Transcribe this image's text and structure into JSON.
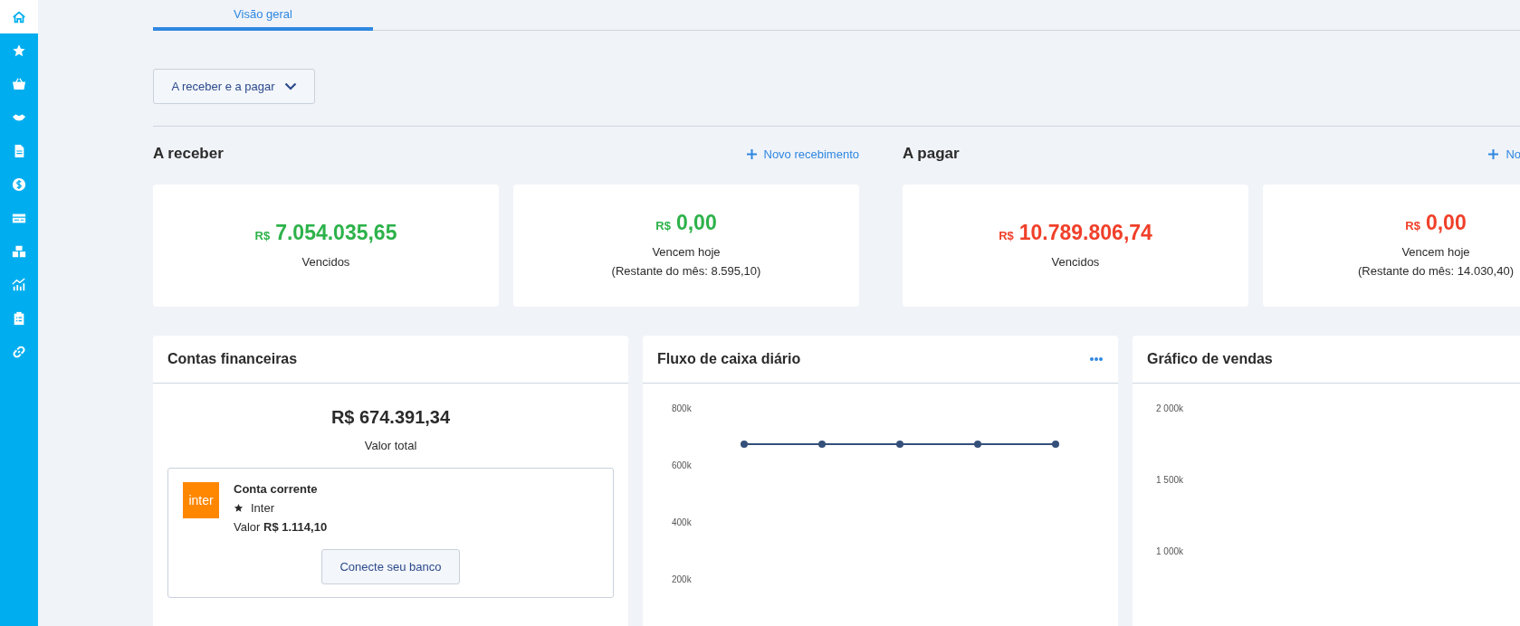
{
  "sidebar": {
    "items": [
      {
        "selected": true
      },
      {
        "selected": false
      },
      {
        "selected": false
      },
      {
        "selected": false
      },
      {
        "selected": false
      },
      {
        "selected": false
      },
      {
        "selected": false
      },
      {
        "selected": false
      },
      {
        "selected": false
      },
      {
        "selected": false
      },
      {
        "selected": false
      }
    ]
  },
  "tabs": [
    {
      "label": "Visão geral",
      "selected": true
    }
  ],
  "filter": {
    "label": "A receber e a pagar"
  },
  "sections": [
    {
      "title": "A receber",
      "action": "Novo recebimento",
      "color": "#2db24a",
      "cards": [
        {
          "currency": "R$",
          "amount": "7.054.035,65",
          "label": "Vencidos"
        },
        {
          "currency": "R$",
          "amount": "0,00",
          "label": "Vencem hoje",
          "note": "(Restante do mês: 8.595,10)"
        }
      ]
    },
    {
      "title": "A pagar",
      "action": "No",
      "color": "#f0402a",
      "cards": [
        {
          "currency": "R$",
          "amount": "10.789.806,74",
          "label": "Vencidos"
        },
        {
          "currency": "R$",
          "amount": "0,00",
          "label": "Vencem hoje",
          "note": "(Restante do mês: 14.030,40)"
        }
      ]
    }
  ],
  "accounts_panel": {
    "title": "Contas financeiras",
    "total": "R$ 674.391,34",
    "total_label": "Valor total",
    "account": {
      "logo": "inter",
      "name": "Conta corrente",
      "bank": "Inter",
      "value": "Valor **R$ 1.114,10**"
    },
    "connect_button": "Conecte seu banco"
  },
  "cashflow_panel": {
    "title": "Fluxo de caixa diário",
    "chart_data": {
      "type": "line",
      "ylim": [
        200000,
        800000
      ],
      "yticks": [
        {
          "value": 200000,
          "label": "200k"
        },
        {
          "value": 400000,
          "label": "400k"
        },
        {
          "value": 600000,
          "label": "600k"
        },
        {
          "value": 800000,
          "label": "800k"
        }
      ],
      "series": [
        {
          "color": "#34507a",
          "marker": "circle",
          "values": [
            676000,
            676000,
            676000,
            676000,
            676000
          ]
        }
      ]
    }
  },
  "sales_panel": {
    "title": "Gráfico de vendas",
    "axis_labels": [
      "2 000k",
      "1 500k",
      "1 000k"
    ]
  }
}
